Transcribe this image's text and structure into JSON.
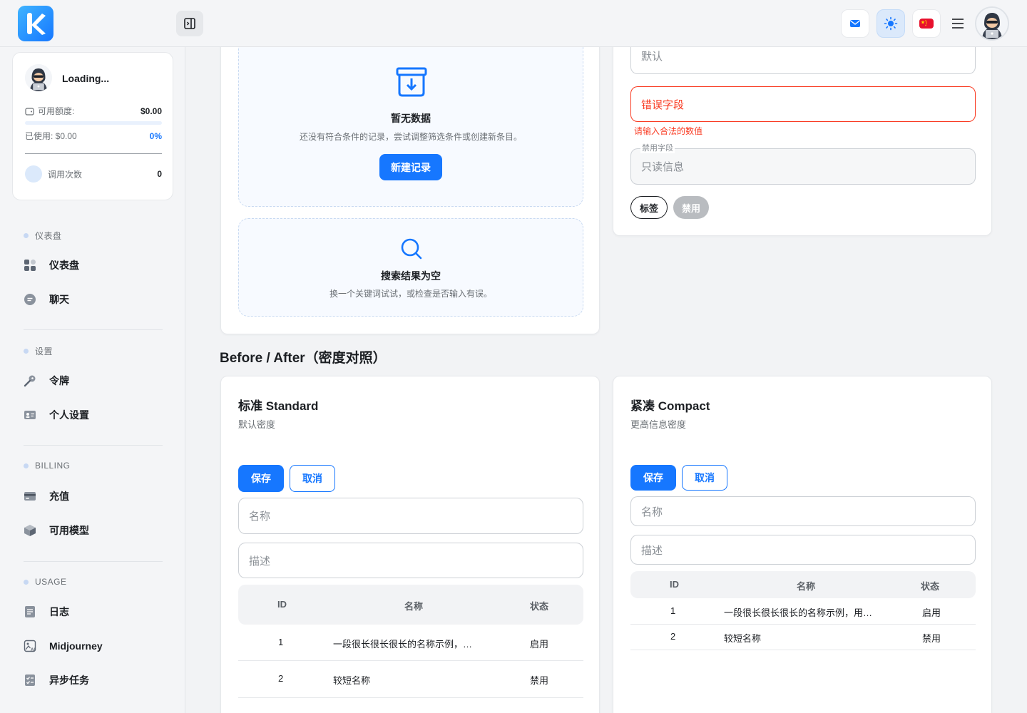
{
  "header": {
    "logo_letter": "K",
    "buttons": [
      "mail-icon",
      "sun-icon",
      "china-flag-icon",
      "menu-icon"
    ]
  },
  "sidebar": {
    "user": {
      "name": "Loading...",
      "balance_label": "可用额度:",
      "balance_value": "$0.00",
      "used_label": "已使用: $0.00",
      "used_percent": "0%",
      "usage_fraction": 0,
      "calls_label": "调用次数",
      "calls_value": "0"
    },
    "sections": [
      {
        "title": "仪表盘",
        "items": [
          {
            "label": "仪表盘",
            "icon": "dashboard-icon"
          },
          {
            "label": "聊天",
            "icon": "chat-icon"
          }
        ]
      },
      {
        "title": "设置",
        "items": [
          {
            "label": "令牌",
            "icon": "key-icon"
          },
          {
            "label": "个人设置",
            "icon": "profile-card-icon"
          }
        ]
      },
      {
        "title": "BILLING",
        "items": [
          {
            "label": "充值",
            "icon": "credit-card-icon"
          },
          {
            "label": "可用模型",
            "icon": "cube-icon"
          }
        ]
      },
      {
        "title": "USAGE",
        "items": [
          {
            "label": "日志",
            "icon": "log-icon"
          },
          {
            "label": "Midjourney",
            "icon": "image-ai-icon"
          },
          {
            "label": "异步任务",
            "icon": "task-list-icon"
          }
        ]
      }
    ]
  },
  "empty_states": {
    "no_data": {
      "title": "暂无数据",
      "desc": "还没有符合条件的记录，尝试调整筛选条件或创建新条目。",
      "button": "新建记录"
    },
    "no_search": {
      "title": "搜索结果为空",
      "desc": "换一个关键词试试，或检查是否输入有误。"
    }
  },
  "form_states": {
    "default_value": "默认",
    "error_value": "错误字段",
    "error_msg": "请输入合法的数值",
    "disabled_legend": "禁用字段",
    "disabled_value": "只读信息",
    "tag_label": "标签",
    "tag_disabled": "禁用"
  },
  "density": {
    "heading": "Before / After（密度对照）",
    "standard": {
      "title": "标准 Standard",
      "subtitle": "默认密度",
      "save": "保存",
      "cancel": "取消",
      "name_placeholder": "名称",
      "desc_placeholder": "描述",
      "columns": [
        "ID",
        "名称",
        "状态"
      ],
      "rows": [
        {
          "id": "1",
          "name": "一段很长很长很长的名称示例，…",
          "status": "启用"
        },
        {
          "id": "2",
          "name": "较短名称",
          "status": "禁用"
        }
      ]
    },
    "compact": {
      "title": "紧凑 Compact",
      "subtitle": "更高信息密度",
      "save": "保存",
      "cancel": "取消",
      "name_placeholder": "名称",
      "desc_placeholder": "描述",
      "columns": [
        "ID",
        "名称",
        "状态"
      ],
      "rows": [
        {
          "id": "1",
          "name": "一段很长很长很长的名称示例，用…",
          "status": "启用"
        },
        {
          "id": "2",
          "name": "较短名称",
          "status": "禁用"
        }
      ]
    }
  },
  "colors": {
    "accent": "#1677ff",
    "error": "#f93920"
  }
}
